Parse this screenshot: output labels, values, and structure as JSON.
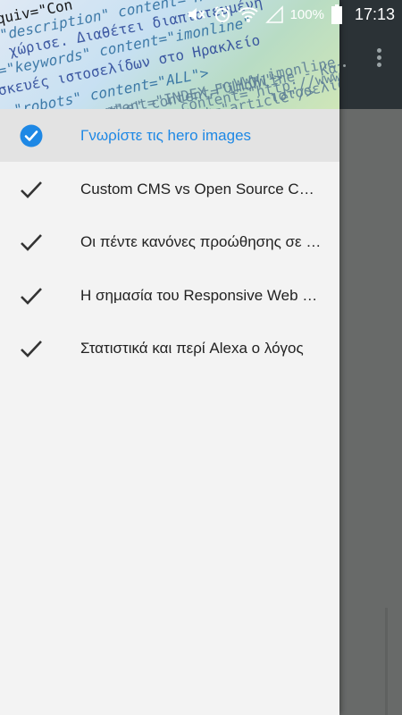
{
  "status_bar": {
    "battery": "100%",
    "time": "17:13"
  },
  "drawer": {
    "header_code": [
      "quiv=\"Con",
      "\"description\" content=\"Η imonline διαθέτει",
      "χώρισε. Διαθέτει διαπιστευμένη",
      "=\"keywords\" content=\"imonline\"",
      "σκευές ιστοσελίδων στο Ηρακλείο",
      "\"robots\" content=\"ALL\">",
      "bots\" content=\"INDEX,FOLLOW\">",
      "tle\" content=\"imonline - Κατασκευή",
      "content=\"article\"/>",
      "content=\"http://www.imonline.gr/",
      "www.imonline.gr/g",
      "ιστοσελίδα πληρο"
    ],
    "items": [
      {
        "label": "Γνωρίστε τις hero images",
        "active": true
      },
      {
        "label": "Custom CMS vs Open Source CMS",
        "active": false
      },
      {
        "label": "Οι πέντε κανόνες προώθησης σε social media",
        "active": false
      },
      {
        "label": "Η σημασία του Responsive Web Design",
        "active": false
      },
      {
        "label": "Στατιστικά και περί Alexa ο λόγος",
        "active": false
      }
    ]
  },
  "colors": {
    "accent": "#1e88e5",
    "check": "#333333",
    "drawer_bg": "#f3f3f3",
    "active_bg": "#e3e3e3",
    "toolbar": "#2b3236",
    "scrim": "#686a69"
  },
  "icons": {
    "status": [
      "mute-icon",
      "alarm-icon",
      "wifi-icon",
      "signal-icon",
      "battery-icon"
    ],
    "items": [
      "check-circle-icon",
      "check-icon"
    ],
    "toolbar": "overflow-menu-icon"
  }
}
